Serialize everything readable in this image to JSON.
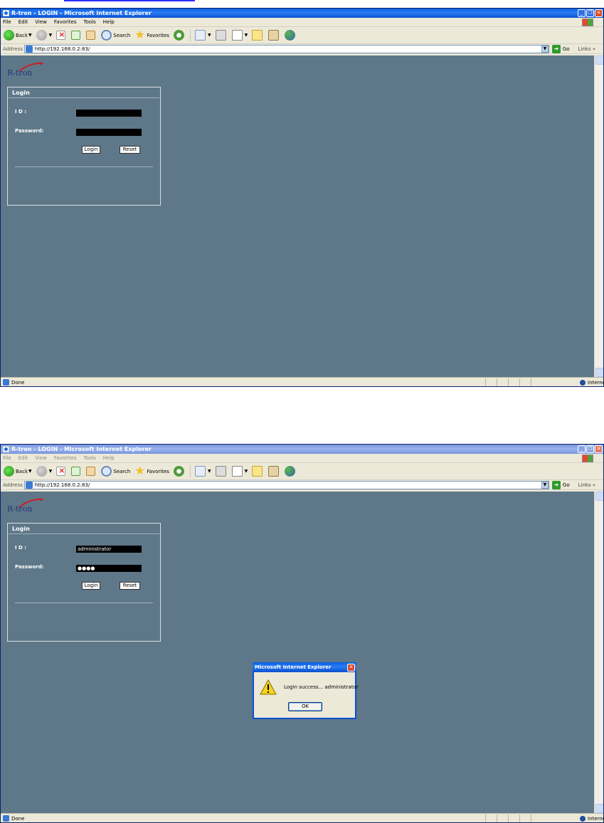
{
  "browser": {
    "window_title": "R-tron - LOGIN - Microsoft Internet Explorer",
    "menu": [
      "File",
      "Edit",
      "View",
      "Favorites",
      "Tools",
      "Help"
    ],
    "toolbar": {
      "back": "Back",
      "search": "Search",
      "favorites": "Favorites"
    },
    "address_label": "Address",
    "url": "http://192.168.0.2:83/",
    "go": "Go",
    "links": "Links",
    "status_text": "Done",
    "zone": "Internet"
  },
  "page": {
    "logo": "R-tron",
    "login_title": "Login",
    "id_label": "I D :",
    "password_label": "Password:",
    "login_button": "Login",
    "reset_button": "Reset"
  },
  "screen1": {
    "id_value": "",
    "password_value": ""
  },
  "screen2": {
    "id_value": "administrator",
    "password_value": "●●●●"
  },
  "dialog": {
    "title": "Microsoft Internet Explorer",
    "message": "Login success... administrator",
    "ok": "OK"
  },
  "colors": {
    "page_bg": "#5e7889",
    "title_active": "#0a5fe0",
    "title_inactive": "#7a96df"
  },
  "icons": [
    "back-icon",
    "forward-icon",
    "stop-icon",
    "refresh-icon",
    "home-icon",
    "search-icon",
    "favorites-icon",
    "history-icon",
    "mail-icon",
    "print-icon",
    "word-icon",
    "note-icon",
    "research-icon",
    "messenger-icon",
    "warning-icon",
    "globe-icon"
  ]
}
